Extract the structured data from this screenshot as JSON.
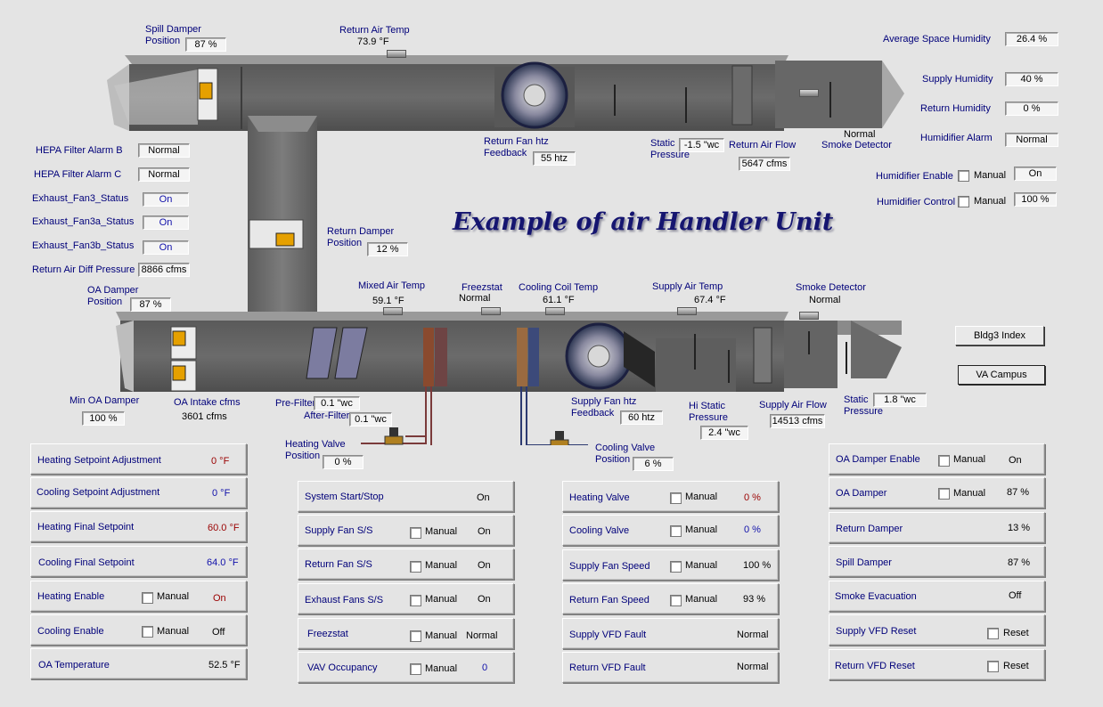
{
  "title": "Example of air Handler Unit",
  "colors": {
    "background": "#e4e4e4",
    "label": "#00007a",
    "title": "#151570",
    "heat": "#9a0000"
  },
  "diagram": {
    "spill_damper": {
      "label1": "Spill Damper",
      "label2": "Position",
      "value": "87 %"
    },
    "return_air_temp": {
      "label": "Return Air Temp",
      "value": "73.9 °F"
    },
    "return_fan": {
      "label1": "Return Fan htz",
      "label2": "Feedback",
      "value": "55 htz"
    },
    "return_static": {
      "label1": "Static",
      "label2": "Pressure",
      "value": "-1.5 \"wc"
    },
    "return_air_flow": {
      "label": "Return Air Flow",
      "value": "5647 cfms"
    },
    "return_smoke": {
      "label1": "Normal",
      "label2": "Smoke Detector"
    },
    "return_damper": {
      "label1": "Return Damper",
      "label2": "Position",
      "value": "12 %"
    },
    "oa_damper": {
      "label1": "OA Damper",
      "label2": "Position",
      "value": "87 %"
    },
    "mixed_air_temp": {
      "label": "Mixed Air Temp",
      "value": "59.1 °F"
    },
    "freezstat": {
      "label": "Freezstat",
      "value": "Normal"
    },
    "cooling_coil_temp": {
      "label": "Cooling Coil Temp",
      "value": "61.1 °F"
    },
    "supply_air_temp": {
      "label": "Supply Air Temp",
      "value": "67.4 °F"
    },
    "supply_smoke": {
      "label": "Smoke Detector",
      "value": "Normal"
    },
    "min_oa_damper": {
      "label": "Min OA Damper",
      "value": "100 %"
    },
    "oa_intake": {
      "label": "OA Intake cfms",
      "value": "3601 cfms"
    },
    "pre_filter": {
      "label": "Pre-Filter",
      "value": "0.1 \"wc"
    },
    "after_filter": {
      "label": "After-Filter",
      "value": "0.1 \"wc"
    },
    "heating_valve": {
      "label1": "Heating Valve",
      "label2": "Position",
      "value": "0 %"
    },
    "cooling_valve": {
      "label1": "Cooling Valve",
      "label2": "Position",
      "value": "6 %"
    },
    "supply_fan": {
      "label1": "Supply Fan htz",
      "label2": "Feedback",
      "value": "60 htz"
    },
    "hi_static": {
      "label1": "Hi Static",
      "label2": "Pressure",
      "value": "2.4 \"wc"
    },
    "supply_air_flow": {
      "label": "Supply Air Flow",
      "value": "14513 cfms"
    },
    "supply_static": {
      "label1": "Static",
      "label2": "Pressure",
      "value": "1.8 \"wc"
    }
  },
  "left_status": [
    {
      "label": "HEPA Filter Alarm B",
      "value": "Normal"
    },
    {
      "label": "HEPA Filter Alarm C",
      "value": "Normal"
    },
    {
      "label": "Exhaust_Fan3_Status",
      "value": "On"
    },
    {
      "label": "Exhaust_Fan3a_Status",
      "value": "On"
    },
    {
      "label": "Exhaust_Fan3b_Status",
      "value": "On"
    },
    {
      "label": "Return Air Diff Pressure",
      "value": "8866 cfms"
    }
  ],
  "right_status": {
    "avg_space_humidity": {
      "label": "Average Space Humidity",
      "value": "26.4 %"
    },
    "supply_humidity": {
      "label": "Supply Humidity",
      "value": "40 %"
    },
    "return_humidity": {
      "label": "Return Humidity",
      "value": "0 %"
    },
    "humidifier_alarm": {
      "label": "Humidifier Alarm",
      "value": "Normal"
    },
    "humidifier_enable": {
      "label": "Humidifier Enable",
      "manual": "Manual",
      "value": "On"
    },
    "humidifier_control": {
      "label": "Humidifier Control",
      "manual": "Manual",
      "value": "100 %"
    }
  },
  "buttons": {
    "bldg_index": "Bldg3 Index",
    "va_campus": "VA Campus"
  },
  "panel1": [
    {
      "label": "Heating Setpoint Adjustment",
      "value": "0 °F",
      "color": "red"
    },
    {
      "label": "Cooling Setpoint Adjustment",
      "value": "0 °F",
      "color": "blu"
    },
    {
      "label": "Heating Final Setpoint",
      "value": "60.0 °F",
      "color": "red"
    },
    {
      "label": "Cooling Final Setpoint",
      "value": "64.0 °F",
      "color": "blu"
    },
    {
      "label": "Heating Enable",
      "manual": "Manual",
      "value": "On",
      "color": "red"
    },
    {
      "label": "Cooling Enable",
      "manual": "Manual",
      "value": "Off",
      "color": "blk"
    },
    {
      "label": "OA Temperature",
      "value": "52.5 °F",
      "color": "blk"
    }
  ],
  "panel2": [
    {
      "label": "System Start/Stop",
      "value": "On"
    },
    {
      "label": "Supply Fan S/S",
      "manual": "Manual",
      "value": "On"
    },
    {
      "label": "Return Fan S/S",
      "manual": "Manual",
      "value": "On"
    },
    {
      "label": "Exhaust Fans S/S",
      "manual": "Manual",
      "value": "On"
    },
    {
      "label": "Freezstat",
      "manual": "Manual",
      "value": "Normal"
    },
    {
      "label": "VAV Occupancy",
      "manual": "Manual",
      "value": "0"
    }
  ],
  "panel3": [
    {
      "label": "Heating Valve",
      "manual": "Manual",
      "value": "0 %",
      "color": "red"
    },
    {
      "label": "Cooling Valve",
      "manual": "Manual",
      "value": "0 %",
      "color": "blu"
    },
    {
      "label": "Supply Fan Speed",
      "manual": "Manual",
      "value": "100 %",
      "color": "blk"
    },
    {
      "label": "Return Fan Speed",
      "manual": "Manual",
      "value": "93 %",
      "color": "blk"
    },
    {
      "label": "Supply VFD Fault",
      "value": "Normal",
      "color": "blk"
    },
    {
      "label": "Return VFD Fault",
      "value": "Normal",
      "color": "blk"
    }
  ],
  "panel4": [
    {
      "label": "OA Damper Enable",
      "manual": "Manual",
      "value": "On"
    },
    {
      "label": "OA Damper",
      "manual": "Manual",
      "value": "87 %"
    },
    {
      "label": "Return Damper",
      "value": "13 %"
    },
    {
      "label": "Spill Damper",
      "value": "87 %"
    },
    {
      "label": "Smoke Evacuation",
      "value": "Off"
    },
    {
      "label": "Supply VFD Reset",
      "reset": "Reset"
    },
    {
      "label": "Return VFD Reset",
      "reset": "Reset"
    }
  ]
}
